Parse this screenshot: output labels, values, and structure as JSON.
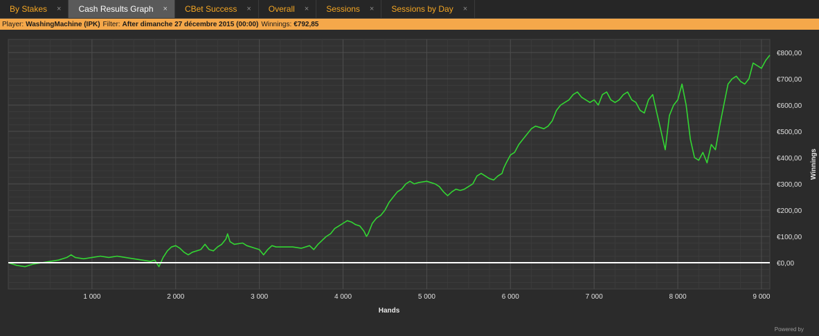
{
  "tabs": [
    {
      "label": "By Stakes",
      "active": false
    },
    {
      "label": "Cash Results Graph",
      "active": true
    },
    {
      "label": "CBet Success",
      "active": false
    },
    {
      "label": "Overall",
      "active": false
    },
    {
      "label": "Sessions",
      "active": false
    },
    {
      "label": "Sessions by Day",
      "active": false
    }
  ],
  "tab_close_glyph": "×",
  "filter_bar": {
    "player_label": "Player:",
    "player_value": "WashingMachine (IPK)",
    "filter_label": "Filter:",
    "filter_value": "After dimanche 27 décembre 2015 (00:00)",
    "winnings_label": "Winnings:",
    "winnings_value": "€792,85"
  },
  "powered_by": "Powered by",
  "colors": {
    "accent": "#f5a623",
    "filter_bg": "#f5a84a",
    "line": "#33d633",
    "zero_line": "#ffffff",
    "plot_bg": "#323232"
  },
  "chart_data": {
    "type": "line",
    "xlabel": "Hands",
    "ylabel": "Winnings",
    "xlim": [
      0,
      9100
    ],
    "ylim": [
      -100,
      850
    ],
    "x_ticks": [
      1000,
      2000,
      3000,
      4000,
      5000,
      6000,
      7000,
      8000,
      9000
    ],
    "x_tick_labels": [
      "1 000",
      "2 000",
      "3 000",
      "4 000",
      "5 000",
      "6 000",
      "7 000",
      "8 000",
      "9 000"
    ],
    "y_ticks": [
      0,
      100,
      200,
      300,
      400,
      500,
      600,
      700,
      800
    ],
    "y_tick_labels": [
      "€0,00",
      "€100,00",
      "€200,00",
      "€300,00",
      "€400,00",
      "€500,00",
      "€600,00",
      "€700,00",
      "€800,00"
    ],
    "grid": true,
    "zero_line": true,
    "series": [
      {
        "points": [
          [
            0,
            0
          ],
          [
            100,
            -10
          ],
          [
            200,
            -15
          ],
          [
            300,
            -5
          ],
          [
            400,
            0
          ],
          [
            500,
            5
          ],
          [
            600,
            10
          ],
          [
            700,
            20
          ],
          [
            750,
            30
          ],
          [
            800,
            20
          ],
          [
            900,
            15
          ],
          [
            1000,
            20
          ],
          [
            1100,
            25
          ],
          [
            1200,
            20
          ],
          [
            1300,
            25
          ],
          [
            1400,
            20
          ],
          [
            1500,
            15
          ],
          [
            1600,
            10
          ],
          [
            1700,
            5
          ],
          [
            1750,
            10
          ],
          [
            1800,
            -15
          ],
          [
            1850,
            20
          ],
          [
            1900,
            45
          ],
          [
            1950,
            60
          ],
          [
            2000,
            65
          ],
          [
            2050,
            55
          ],
          [
            2100,
            40
          ],
          [
            2150,
            30
          ],
          [
            2200,
            40
          ],
          [
            2300,
            50
          ],
          [
            2350,
            70
          ],
          [
            2400,
            50
          ],
          [
            2450,
            45
          ],
          [
            2500,
            60
          ],
          [
            2550,
            70
          ],
          [
            2600,
            90
          ],
          [
            2620,
            110
          ],
          [
            2650,
            80
          ],
          [
            2700,
            70
          ],
          [
            2800,
            75
          ],
          [
            2850,
            65
          ],
          [
            2900,
            60
          ],
          [
            2950,
            55
          ],
          [
            3000,
            50
          ],
          [
            3050,
            30
          ],
          [
            3100,
            50
          ],
          [
            3150,
            65
          ],
          [
            3200,
            60
          ],
          [
            3300,
            60
          ],
          [
            3400,
            60
          ],
          [
            3500,
            55
          ],
          [
            3600,
            65
          ],
          [
            3650,
            50
          ],
          [
            3700,
            70
          ],
          [
            3750,
            85
          ],
          [
            3800,
            100
          ],
          [
            3850,
            110
          ],
          [
            3900,
            130
          ],
          [
            3950,
            140
          ],
          [
            4000,
            150
          ],
          [
            4050,
            160
          ],
          [
            4100,
            155
          ],
          [
            4150,
            145
          ],
          [
            4200,
            140
          ],
          [
            4250,
            120
          ],
          [
            4280,
            100
          ],
          [
            4300,
            110
          ],
          [
            4350,
            150
          ],
          [
            4400,
            170
          ],
          [
            4450,
            180
          ],
          [
            4500,
            200
          ],
          [
            4550,
            230
          ],
          [
            4600,
            250
          ],
          [
            4650,
            270
          ],
          [
            4700,
            280
          ],
          [
            4750,
            300
          ],
          [
            4800,
            310
          ],
          [
            4850,
            300
          ],
          [
            4900,
            305
          ],
          [
            5000,
            310
          ],
          [
            5100,
            300
          ],
          [
            5150,
            290
          ],
          [
            5200,
            270
          ],
          [
            5250,
            255
          ],
          [
            5300,
            270
          ],
          [
            5350,
            280
          ],
          [
            5400,
            275
          ],
          [
            5450,
            280
          ],
          [
            5500,
            290
          ],
          [
            5550,
            300
          ],
          [
            5600,
            330
          ],
          [
            5650,
            340
          ],
          [
            5700,
            330
          ],
          [
            5750,
            320
          ],
          [
            5800,
            315
          ],
          [
            5850,
            330
          ],
          [
            5900,
            340
          ],
          [
            5920,
            360
          ],
          [
            5950,
            380
          ],
          [
            6000,
            410
          ],
          [
            6050,
            420
          ],
          [
            6100,
            450
          ],
          [
            6150,
            470
          ],
          [
            6200,
            490
          ],
          [
            6250,
            510
          ],
          [
            6300,
            520
          ],
          [
            6350,
            515
          ],
          [
            6400,
            510
          ],
          [
            6450,
            520
          ],
          [
            6500,
            540
          ],
          [
            6550,
            580
          ],
          [
            6600,
            600
          ],
          [
            6650,
            610
          ],
          [
            6700,
            620
          ],
          [
            6750,
            640
          ],
          [
            6800,
            650
          ],
          [
            6850,
            630
          ],
          [
            6900,
            620
          ],
          [
            6950,
            610
          ],
          [
            7000,
            620
          ],
          [
            7050,
            600
          ],
          [
            7100,
            640
          ],
          [
            7150,
            650
          ],
          [
            7200,
            620
          ],
          [
            7250,
            610
          ],
          [
            7300,
            620
          ],
          [
            7350,
            640
          ],
          [
            7400,
            650
          ],
          [
            7450,
            620
          ],
          [
            7500,
            610
          ],
          [
            7550,
            580
          ],
          [
            7600,
            570
          ],
          [
            7650,
            620
          ],
          [
            7700,
            640
          ],
          [
            7750,
            570
          ],
          [
            7800,
            500
          ],
          [
            7850,
            430
          ],
          [
            7900,
            560
          ],
          [
            7950,
            600
          ],
          [
            8000,
            620
          ],
          [
            8050,
            680
          ],
          [
            8100,
            600
          ],
          [
            8150,
            470
          ],
          [
            8200,
            400
          ],
          [
            8250,
            390
          ],
          [
            8300,
            420
          ],
          [
            8350,
            380
          ],
          [
            8400,
            450
          ],
          [
            8450,
            430
          ],
          [
            8500,
            520
          ],
          [
            8550,
            600
          ],
          [
            8600,
            680
          ],
          [
            8650,
            700
          ],
          [
            8700,
            710
          ],
          [
            8750,
            690
          ],
          [
            8800,
            680
          ],
          [
            8850,
            700
          ],
          [
            8900,
            760
          ],
          [
            8950,
            750
          ],
          [
            9000,
            740
          ],
          [
            9050,
            770
          ],
          [
            9100,
            790
          ]
        ]
      }
    ]
  }
}
